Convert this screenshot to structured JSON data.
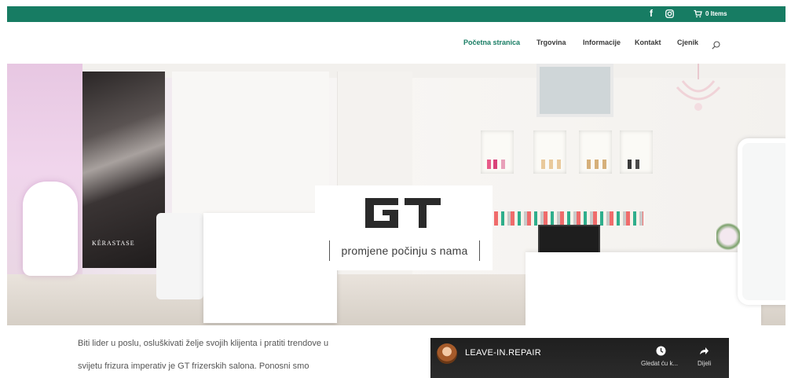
{
  "topbar": {
    "facebook_glyph": "f",
    "instagram_icon": "instagram-icon",
    "cart_icon": "cart-icon",
    "cart_items": "0 Items",
    "background": "#177c63"
  },
  "nav": {
    "items": [
      {
        "label": "Početna stranica",
        "active": true
      },
      {
        "label": "Trgovina",
        "active": false
      },
      {
        "label": "Informacije",
        "active": false
      },
      {
        "label": "Kontakt",
        "active": false
      },
      {
        "label": "Cjenik",
        "active": false
      }
    ],
    "search_icon": "search-icon",
    "active_color": "#177c63"
  },
  "hero": {
    "poster_brand": "KÉRASTASE",
    "logo_text": "GT",
    "tagline": "promjene počinju s nama"
  },
  "intro": {
    "line1": "Biti lider u poslu, osluškivati želje svojih klijenta i pratiti trendove u",
    "line2": "svijetu frizura imperativ je GT frizerskih salona.  Ponosni smo"
  },
  "video": {
    "title": "LEAVE-IN.REPAIR",
    "watch_later": "Gledat ću k...",
    "share": "Dijeli"
  }
}
